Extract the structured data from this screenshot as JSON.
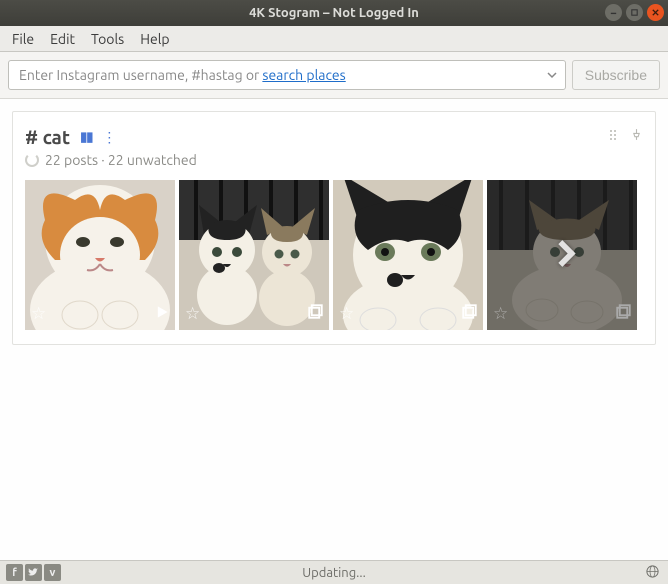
{
  "window": {
    "title": "4K Stogram – Not Logged In"
  },
  "menubar": {
    "items": [
      "File",
      "Edit",
      "Tools",
      "Help"
    ]
  },
  "search": {
    "placeholder_prefix": "Enter Instagram username, #hastag or ",
    "placeholder_link": "search places",
    "subscribe_label": "Subscribe"
  },
  "subscription": {
    "title": "# cat",
    "posts_count": 22,
    "unwatched_count": 22,
    "sub_text": "22 posts · 22 unwatched",
    "thumbs": [
      {
        "kind": "video",
        "starred": false
      },
      {
        "kind": "multi",
        "starred": false
      },
      {
        "kind": "multi",
        "starred": false
      },
      {
        "kind": "multi",
        "starred": false,
        "more": true
      }
    ]
  },
  "statusbar": {
    "text": "Updating...",
    "social": [
      "facebook",
      "twitter",
      "vimeo"
    ]
  }
}
